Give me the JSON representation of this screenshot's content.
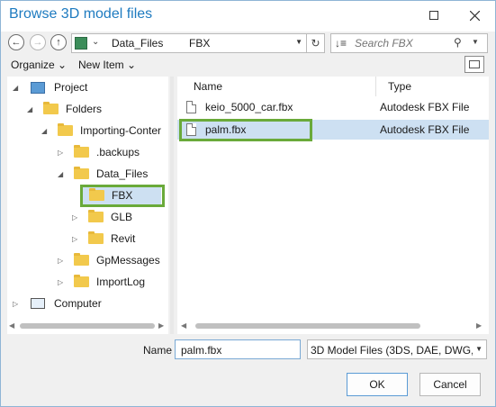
{
  "window": {
    "title": "Browse 3D model files"
  },
  "titlebar": {
    "maximize_icon": "maximize-icon",
    "close_icon": "close-icon"
  },
  "address_bar": {
    "segments": [
      "Data_Files",
      "FBX"
    ]
  },
  "search": {
    "placeholder": "Search FBX"
  },
  "commands": {
    "organize": "Organize",
    "new_item": "New Item"
  },
  "tree": {
    "items": [
      {
        "label": "Project"
      },
      {
        "label": "Folders"
      },
      {
        "label": "Importing-Conter"
      },
      {
        "label": ".backups"
      },
      {
        "label": "Data_Files"
      },
      {
        "label": "FBX"
      },
      {
        "label": "GLB"
      },
      {
        "label": "Revit"
      },
      {
        "label": "GpMessages"
      },
      {
        "label": "ImportLog"
      },
      {
        "label": "Computer"
      }
    ]
  },
  "files": {
    "columns": [
      "Name",
      "Type"
    ],
    "rows": [
      {
        "name": "keio_5000_car.fbx",
        "type": "Autodesk FBX File"
      },
      {
        "name": "palm.fbx",
        "type": "Autodesk FBX File"
      }
    ]
  },
  "footer": {
    "name_label": "Name",
    "name_value": "palm.fbx",
    "filter_value": "3D Model Files (3DS, DAE, DWG, F",
    "ok": "OK",
    "cancel": "Cancel"
  }
}
